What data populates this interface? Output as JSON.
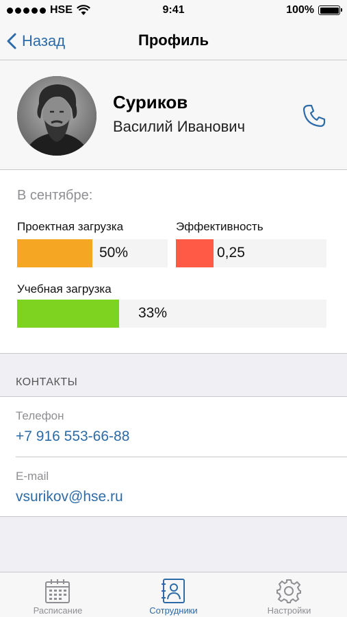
{
  "status_bar": {
    "carrier": "HSE",
    "time": "9:41",
    "battery": "100%"
  },
  "nav": {
    "back_label": "Назад",
    "title": "Профиль"
  },
  "profile": {
    "surname": "Суриков",
    "given_names": "Василий Иванович"
  },
  "stats": {
    "period_label": "В сентябре:",
    "project_load": {
      "label": "Проектная загрузка",
      "value": "50%",
      "fraction": 0.5,
      "color": "#f5a623"
    },
    "efficiency": {
      "label": "Эффективность",
      "value": "0,25",
      "fraction": 0.25,
      "color": "#ff5a45"
    },
    "study_load": {
      "label": "Учебная загрузка",
      "value": "33%",
      "fraction": 0.33,
      "color": "#7ed321"
    }
  },
  "contacts": {
    "header": "КОНТАКТЫ",
    "phone": {
      "label": "Телефон",
      "value": "+7 916 553-66-88"
    },
    "email": {
      "label": "E-mail",
      "value": "vsurikov@hse.ru"
    }
  },
  "tabs": [
    {
      "label": "Расписание",
      "icon": "calendar-icon",
      "active": false
    },
    {
      "label": "Сотрудники",
      "icon": "contacts-book-icon",
      "active": true
    },
    {
      "label": "Настройки",
      "icon": "gear-icon",
      "active": false
    }
  ],
  "colors": {
    "accent": "#2c6ba8",
    "inactive": "#8e8e93"
  }
}
